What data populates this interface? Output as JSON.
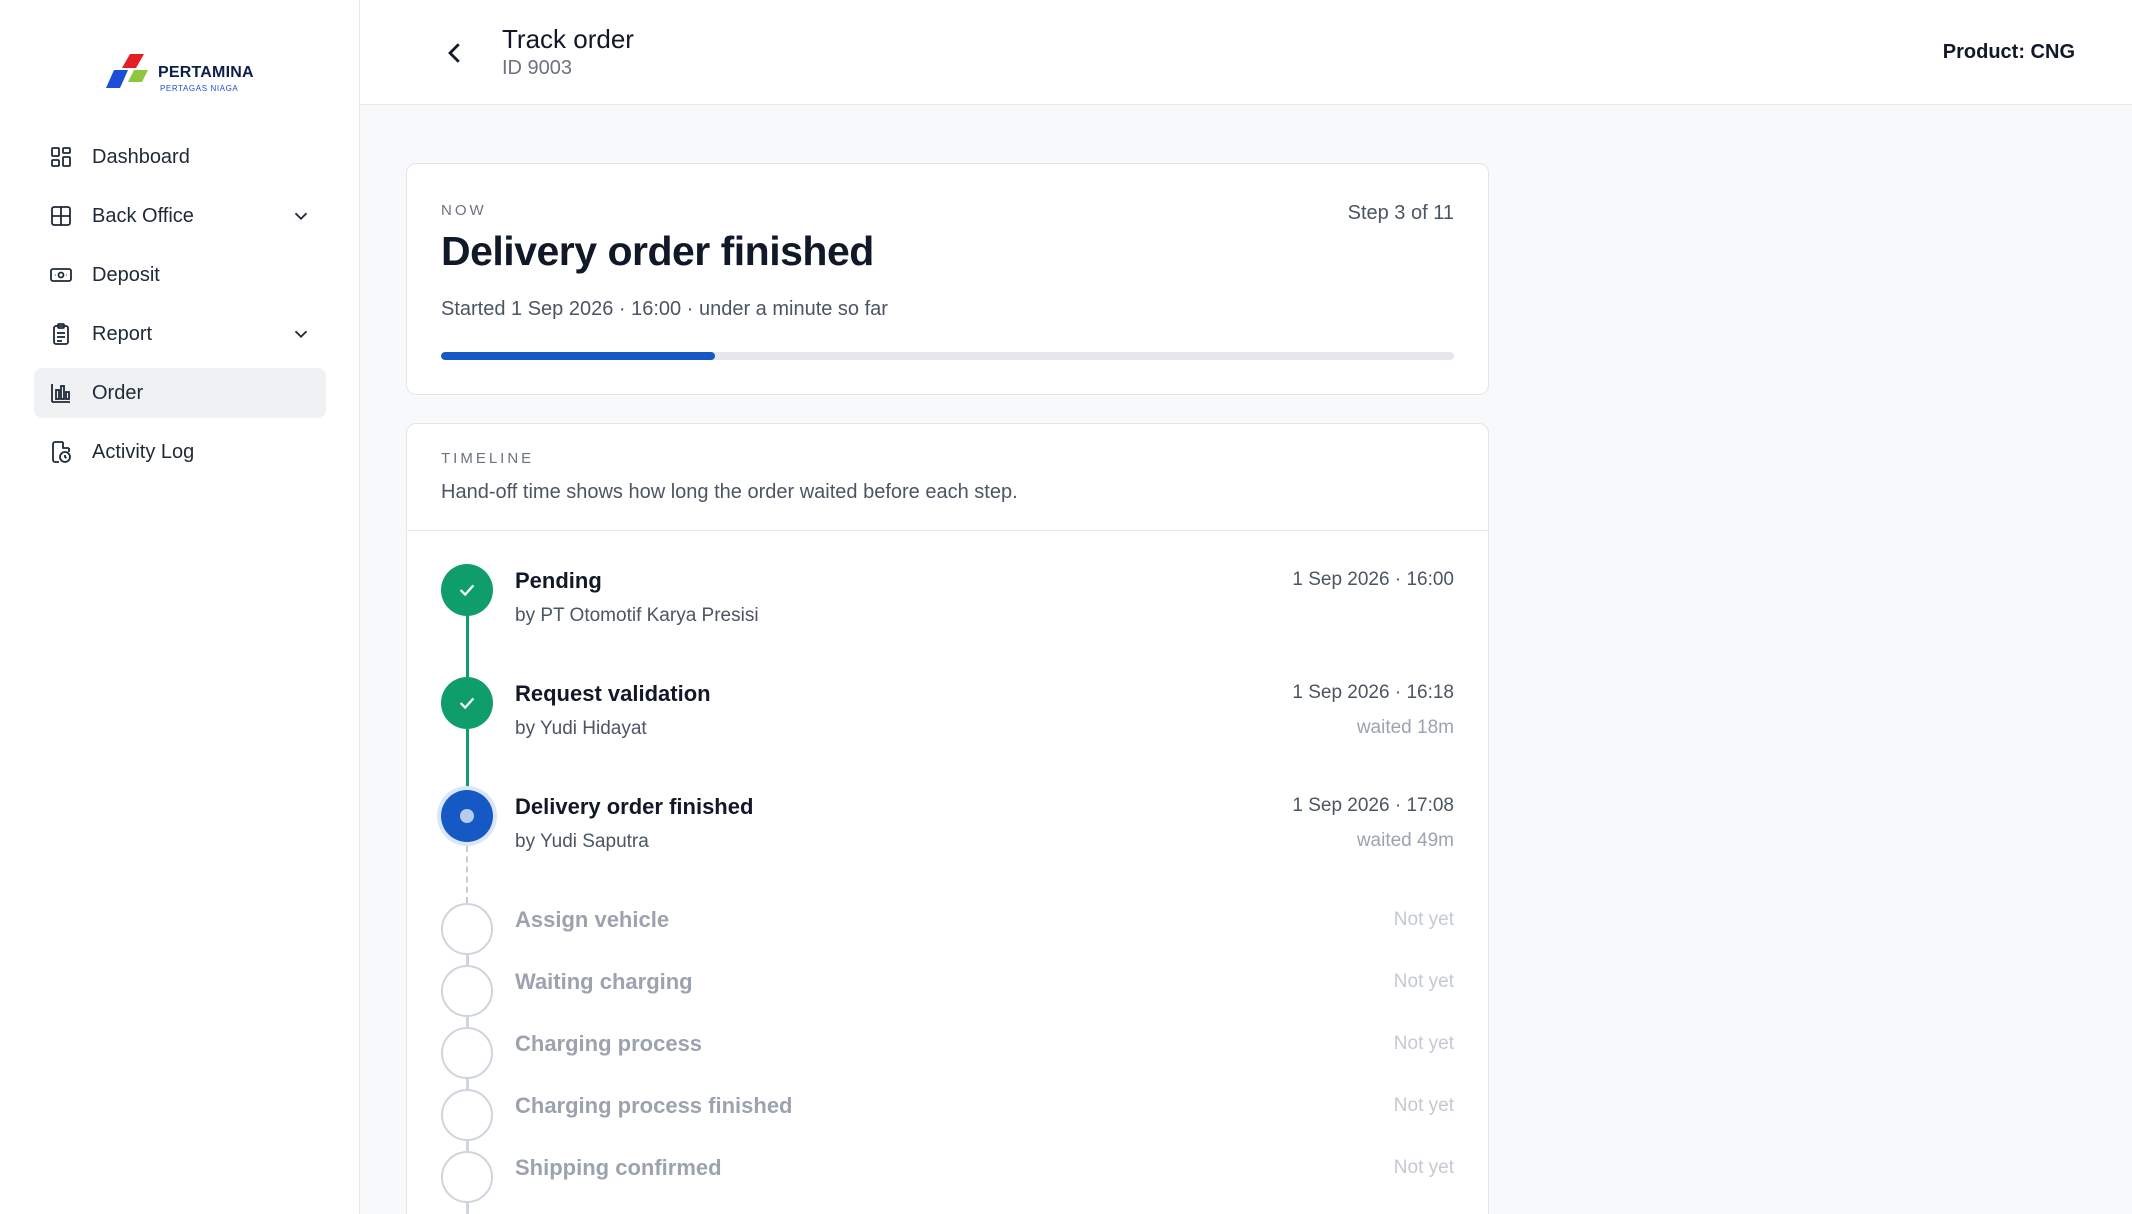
{
  "brand": {
    "name": "PERTAMINA",
    "sub": "PERTAGAS NIAGA",
    "colors": {
      "red": "#e31e24",
      "green": "#8dc63f",
      "blue": "#1d4ed8"
    }
  },
  "sidebar": {
    "items": [
      {
        "label": "Dashboard",
        "icon": "dashboard-icon",
        "has_chevron": false,
        "active": false
      },
      {
        "label": "Back Office",
        "icon": "back-office-icon",
        "has_chevron": true,
        "active": false
      },
      {
        "label": "Deposit",
        "icon": "deposit-icon",
        "has_chevron": false,
        "active": false
      },
      {
        "label": "Report",
        "icon": "report-icon",
        "has_chevron": true,
        "active": false
      },
      {
        "label": "Order",
        "icon": "order-icon",
        "has_chevron": false,
        "active": true
      },
      {
        "label": "Activity Log",
        "icon": "activity-log-icon",
        "has_chevron": false,
        "active": false
      }
    ]
  },
  "header": {
    "title": "Track order",
    "subtitle": "ID 9003",
    "product": "Product: CNG"
  },
  "now_card": {
    "eyebrow": "NOW",
    "title": "Delivery order finished",
    "step_count": "Step 3 of 11",
    "started": "Started 1 Sep 2026 · 16:00 · under a minute so far",
    "progress_fraction": 0.27
  },
  "timeline": {
    "eyebrow": "TIMELINE",
    "description": "Hand-off time shows how long the order waited before each step.",
    "steps": [
      {
        "title": "Pending",
        "by": "by PT Otomotif Karya Presisi",
        "time": "1 Sep 2026 · 16:00",
        "wait": "",
        "status": "done"
      },
      {
        "title": "Request validation",
        "by": "by Yudi Hidayat",
        "time": "1 Sep 2026 · 16:18",
        "wait": "waited 18m",
        "status": "done"
      },
      {
        "title": "Delivery order finished",
        "by": "by Yudi Saputra",
        "time": "1 Sep 2026 · 17:08",
        "wait": "waited 49m",
        "status": "current"
      },
      {
        "title": "Assign vehicle",
        "time": "Not yet",
        "status": "todo"
      },
      {
        "title": "Waiting charging",
        "time": "Not yet",
        "status": "todo"
      },
      {
        "title": "Charging process",
        "time": "Not yet",
        "status": "todo"
      },
      {
        "title": "Charging process finished",
        "time": "Not yet",
        "status": "todo"
      },
      {
        "title": "Shipping confirmed",
        "time": "Not yet",
        "status": "todo"
      }
    ]
  }
}
